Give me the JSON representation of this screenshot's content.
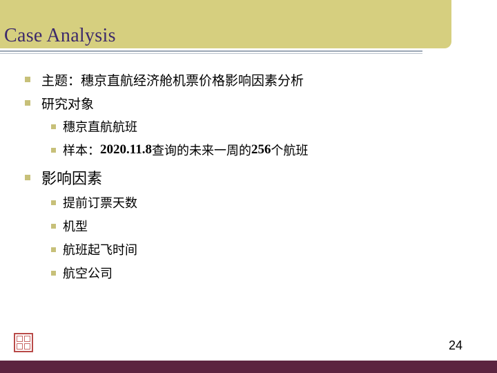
{
  "slide": {
    "title": "Case Analysis",
    "page_number": "24"
  },
  "bullets": {
    "b1": "主题：穗京直航经济舱机票价格影响因素分析",
    "b2": "研究对象",
    "b2_1": "穗京直航航班",
    "b2_2_prefix": "样本：",
    "b2_2_date": "2020.11.8",
    "b2_2_mid": "查询的未来一周的",
    "b2_2_count": "256",
    "b2_2_suffix": "个航班",
    "b3": "影响因素",
    "b3_1": "提前订票天数",
    "b3_2": "机型",
    "b3_3": "航班起飞时间",
    "b3_4": "航空公司"
  }
}
